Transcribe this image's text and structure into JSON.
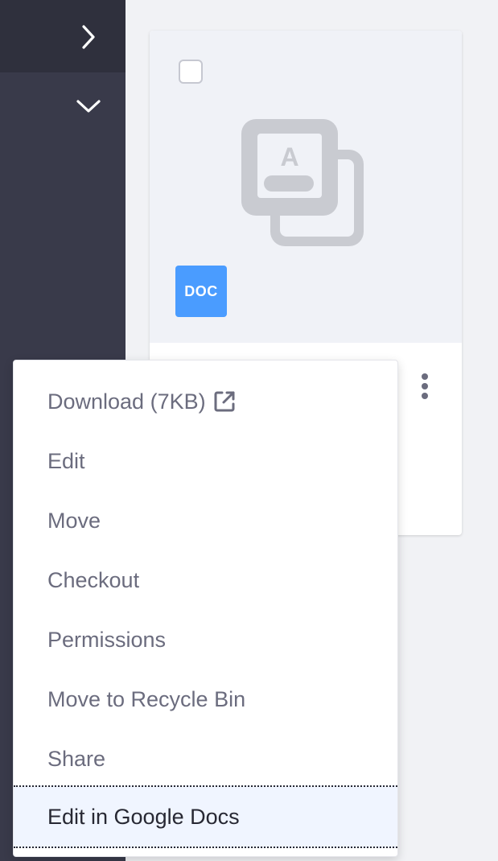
{
  "sidebar": {
    "expand_icon": "chevron-right-icon",
    "collapse_icon": "chevron-down-icon"
  },
  "card": {
    "badge": "DOC",
    "thumbnail_icon": "documents-icon",
    "checked": false
  },
  "menu": {
    "items": [
      {
        "label": "Download (7KB)",
        "icon": "external-link-icon"
      },
      {
        "label": "Edit"
      },
      {
        "label": "Move"
      },
      {
        "label": "Checkout"
      },
      {
        "label": "Permissions"
      },
      {
        "label": "Move to Recycle Bin"
      },
      {
        "label": "Share"
      },
      {
        "label": "Edit in Google Docs",
        "focused": true
      }
    ]
  },
  "colors": {
    "sidebar_bg": "#393a4a",
    "sidebar_top_bg": "#2f303d",
    "badge_bg": "#4a9cff",
    "focused_item_bg": "#f0f5ff",
    "menu_text": "#6b6c7e"
  }
}
